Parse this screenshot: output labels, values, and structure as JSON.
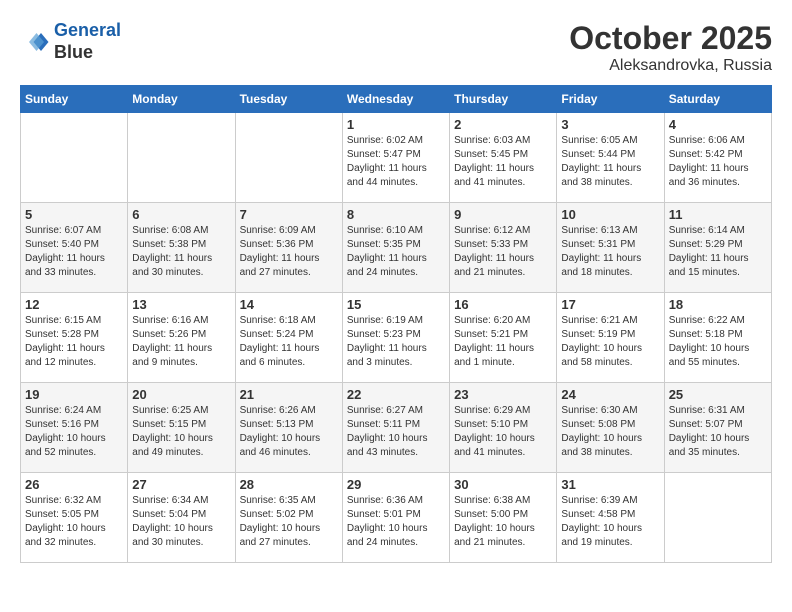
{
  "header": {
    "logo_line1": "General",
    "logo_line2": "Blue",
    "month": "October 2025",
    "location": "Aleksandrovka, Russia"
  },
  "weekdays": [
    "Sunday",
    "Monday",
    "Tuesday",
    "Wednesday",
    "Thursday",
    "Friday",
    "Saturday"
  ],
  "weeks": [
    [
      {
        "day": "",
        "sunrise": "",
        "sunset": "",
        "daylight": ""
      },
      {
        "day": "",
        "sunrise": "",
        "sunset": "",
        "daylight": ""
      },
      {
        "day": "",
        "sunrise": "",
        "sunset": "",
        "daylight": ""
      },
      {
        "day": "1",
        "sunrise": "Sunrise: 6:02 AM",
        "sunset": "Sunset: 5:47 PM",
        "daylight": "Daylight: 11 hours and 44 minutes."
      },
      {
        "day": "2",
        "sunrise": "Sunrise: 6:03 AM",
        "sunset": "Sunset: 5:45 PM",
        "daylight": "Daylight: 11 hours and 41 minutes."
      },
      {
        "day": "3",
        "sunrise": "Sunrise: 6:05 AM",
        "sunset": "Sunset: 5:44 PM",
        "daylight": "Daylight: 11 hours and 38 minutes."
      },
      {
        "day": "4",
        "sunrise": "Sunrise: 6:06 AM",
        "sunset": "Sunset: 5:42 PM",
        "daylight": "Daylight: 11 hours and 36 minutes."
      }
    ],
    [
      {
        "day": "5",
        "sunrise": "Sunrise: 6:07 AM",
        "sunset": "Sunset: 5:40 PM",
        "daylight": "Daylight: 11 hours and 33 minutes."
      },
      {
        "day": "6",
        "sunrise": "Sunrise: 6:08 AM",
        "sunset": "Sunset: 5:38 PM",
        "daylight": "Daylight: 11 hours and 30 minutes."
      },
      {
        "day": "7",
        "sunrise": "Sunrise: 6:09 AM",
        "sunset": "Sunset: 5:36 PM",
        "daylight": "Daylight: 11 hours and 27 minutes."
      },
      {
        "day": "8",
        "sunrise": "Sunrise: 6:10 AM",
        "sunset": "Sunset: 5:35 PM",
        "daylight": "Daylight: 11 hours and 24 minutes."
      },
      {
        "day": "9",
        "sunrise": "Sunrise: 6:12 AM",
        "sunset": "Sunset: 5:33 PM",
        "daylight": "Daylight: 11 hours and 21 minutes."
      },
      {
        "day": "10",
        "sunrise": "Sunrise: 6:13 AM",
        "sunset": "Sunset: 5:31 PM",
        "daylight": "Daylight: 11 hours and 18 minutes."
      },
      {
        "day": "11",
        "sunrise": "Sunrise: 6:14 AM",
        "sunset": "Sunset: 5:29 PM",
        "daylight": "Daylight: 11 hours and 15 minutes."
      }
    ],
    [
      {
        "day": "12",
        "sunrise": "Sunrise: 6:15 AM",
        "sunset": "Sunset: 5:28 PM",
        "daylight": "Daylight: 11 hours and 12 minutes."
      },
      {
        "day": "13",
        "sunrise": "Sunrise: 6:16 AM",
        "sunset": "Sunset: 5:26 PM",
        "daylight": "Daylight: 11 hours and 9 minutes."
      },
      {
        "day": "14",
        "sunrise": "Sunrise: 6:18 AM",
        "sunset": "Sunset: 5:24 PM",
        "daylight": "Daylight: 11 hours and 6 minutes."
      },
      {
        "day": "15",
        "sunrise": "Sunrise: 6:19 AM",
        "sunset": "Sunset: 5:23 PM",
        "daylight": "Daylight: 11 hours and 3 minutes."
      },
      {
        "day": "16",
        "sunrise": "Sunrise: 6:20 AM",
        "sunset": "Sunset: 5:21 PM",
        "daylight": "Daylight: 11 hours and 1 minute."
      },
      {
        "day": "17",
        "sunrise": "Sunrise: 6:21 AM",
        "sunset": "Sunset: 5:19 PM",
        "daylight": "Daylight: 10 hours and 58 minutes."
      },
      {
        "day": "18",
        "sunrise": "Sunrise: 6:22 AM",
        "sunset": "Sunset: 5:18 PM",
        "daylight": "Daylight: 10 hours and 55 minutes."
      }
    ],
    [
      {
        "day": "19",
        "sunrise": "Sunrise: 6:24 AM",
        "sunset": "Sunset: 5:16 PM",
        "daylight": "Daylight: 10 hours and 52 minutes."
      },
      {
        "day": "20",
        "sunrise": "Sunrise: 6:25 AM",
        "sunset": "Sunset: 5:15 PM",
        "daylight": "Daylight: 10 hours and 49 minutes."
      },
      {
        "day": "21",
        "sunrise": "Sunrise: 6:26 AM",
        "sunset": "Sunset: 5:13 PM",
        "daylight": "Daylight: 10 hours and 46 minutes."
      },
      {
        "day": "22",
        "sunrise": "Sunrise: 6:27 AM",
        "sunset": "Sunset: 5:11 PM",
        "daylight": "Daylight: 10 hours and 43 minutes."
      },
      {
        "day": "23",
        "sunrise": "Sunrise: 6:29 AM",
        "sunset": "Sunset: 5:10 PM",
        "daylight": "Daylight: 10 hours and 41 minutes."
      },
      {
        "day": "24",
        "sunrise": "Sunrise: 6:30 AM",
        "sunset": "Sunset: 5:08 PM",
        "daylight": "Daylight: 10 hours and 38 minutes."
      },
      {
        "day": "25",
        "sunrise": "Sunrise: 6:31 AM",
        "sunset": "Sunset: 5:07 PM",
        "daylight": "Daylight: 10 hours and 35 minutes."
      }
    ],
    [
      {
        "day": "26",
        "sunrise": "Sunrise: 6:32 AM",
        "sunset": "Sunset: 5:05 PM",
        "daylight": "Daylight: 10 hours and 32 minutes."
      },
      {
        "day": "27",
        "sunrise": "Sunrise: 6:34 AM",
        "sunset": "Sunset: 5:04 PM",
        "daylight": "Daylight: 10 hours and 30 minutes."
      },
      {
        "day": "28",
        "sunrise": "Sunrise: 6:35 AM",
        "sunset": "Sunset: 5:02 PM",
        "daylight": "Daylight: 10 hours and 27 minutes."
      },
      {
        "day": "29",
        "sunrise": "Sunrise: 6:36 AM",
        "sunset": "Sunset: 5:01 PM",
        "daylight": "Daylight: 10 hours and 24 minutes."
      },
      {
        "day": "30",
        "sunrise": "Sunrise: 6:38 AM",
        "sunset": "Sunset: 5:00 PM",
        "daylight": "Daylight: 10 hours and 21 minutes."
      },
      {
        "day": "31",
        "sunrise": "Sunrise: 6:39 AM",
        "sunset": "Sunset: 4:58 PM",
        "daylight": "Daylight: 10 hours and 19 minutes."
      },
      {
        "day": "",
        "sunrise": "",
        "sunset": "",
        "daylight": ""
      }
    ]
  ]
}
